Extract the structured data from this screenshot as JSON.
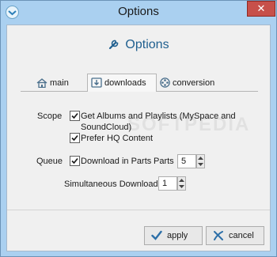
{
  "window": {
    "title": "Options",
    "close_glyph": "✕"
  },
  "header": {
    "icon": "wrench-icon",
    "title": "Options"
  },
  "tabs": [
    {
      "label": "main",
      "icon": "house-icon",
      "active": false
    },
    {
      "label": "downloads",
      "icon": "download-icon",
      "active": true
    },
    {
      "label": "conversion",
      "icon": "film-reel-icon",
      "active": false
    }
  ],
  "form": {
    "scope_label": "Scope",
    "get_albums_label": "Get Albums and Playlists (MySpace and SoundCloud)",
    "get_albums_checked": true,
    "prefer_hq_label": "Prefer HQ Content",
    "prefer_hq_checked": true,
    "queue_label": "Queue",
    "download_parts_label": "Download in Parts",
    "download_parts_checked": true,
    "parts_label": "Parts",
    "parts_value": "5",
    "simultaneous_label": "Simultaneous Downloads",
    "simultaneous_value": "1"
  },
  "buttons": {
    "apply_label": "apply",
    "cancel_label": "cancel"
  },
  "colors": {
    "titlebar": "#aad0f0",
    "close_button": "#c7504a",
    "header_text": "#1f5f8f",
    "check_mark": "#1a1a1a"
  }
}
